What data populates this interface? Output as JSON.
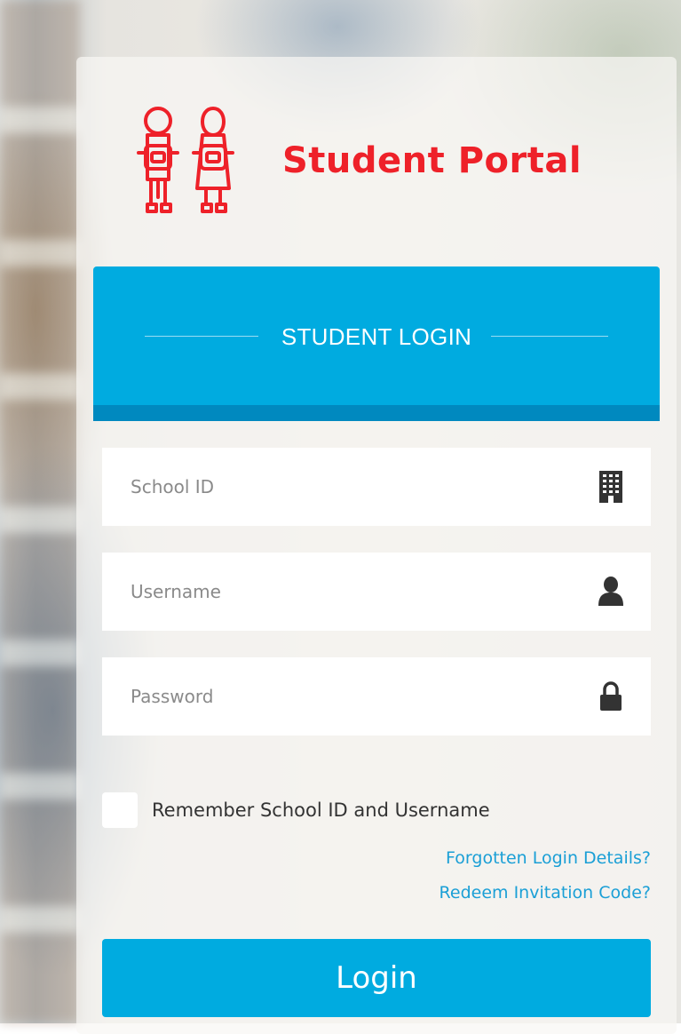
{
  "brand": {
    "title": "Student Portal",
    "color": "#ee2129",
    "logo_icon": "students-icon"
  },
  "banner": {
    "title": "STUDENT LOGIN",
    "color": "#00abe0"
  },
  "form": {
    "school_id": {
      "placeholder": "School ID",
      "icon": "building-icon"
    },
    "username": {
      "placeholder": "Username",
      "icon": "user-icon"
    },
    "password": {
      "placeholder": "Password",
      "icon": "lock-icon"
    },
    "remember_label": "Remember School ID and Username",
    "remember_checked": false
  },
  "links": {
    "forgot": "Forgotten Login Details?",
    "redeem": "Redeem Invitation Code?",
    "color": "#1a9fd6"
  },
  "login_button": {
    "label": "Login",
    "color": "#00abe0"
  }
}
